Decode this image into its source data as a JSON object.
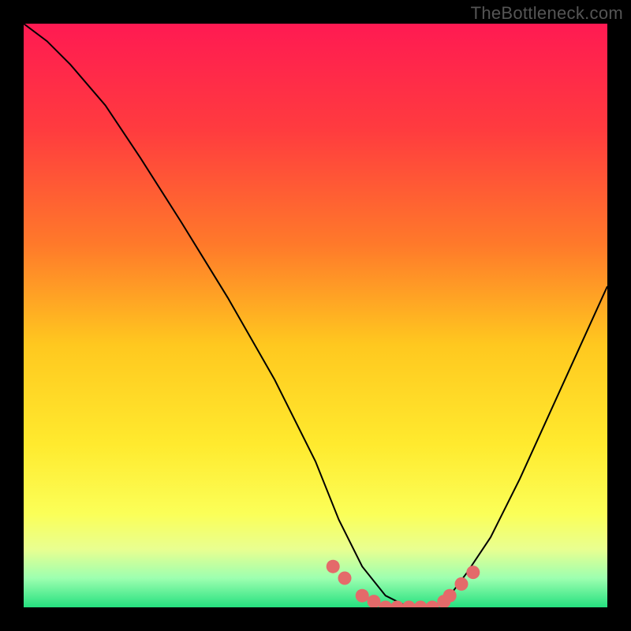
{
  "watermark": "TheBottleneck.com",
  "chart_data": {
    "type": "line",
    "title": "",
    "xlabel": "",
    "ylabel": "",
    "xlim": [
      0,
      100
    ],
    "ylim": [
      0,
      100
    ],
    "grid": false,
    "legend": false,
    "gradient_stops": [
      {
        "offset": 0,
        "color": "#ff1a52"
      },
      {
        "offset": 18,
        "color": "#ff3b3f"
      },
      {
        "offset": 38,
        "color": "#ff7a2a"
      },
      {
        "offset": 55,
        "color": "#ffc81f"
      },
      {
        "offset": 72,
        "color": "#ffea2e"
      },
      {
        "offset": 84,
        "color": "#fbff58"
      },
      {
        "offset": 90,
        "color": "#e9ff90"
      },
      {
        "offset": 95,
        "color": "#9dffb0"
      },
      {
        "offset": 100,
        "color": "#25e07f"
      }
    ],
    "series": [
      {
        "name": "curve",
        "color": "#000000",
        "x": [
          0,
          4,
          8,
          14,
          20,
          27,
          35,
          43,
          50,
          54,
          58,
          62,
          66,
          70,
          73,
          76,
          80,
          85,
          90,
          95,
          100
        ],
        "y": [
          100,
          97,
          93,
          86,
          77,
          66,
          53,
          39,
          25,
          15,
          7,
          2,
          0,
          0,
          2,
          6,
          12,
          22,
          33,
          44,
          55
        ]
      }
    ],
    "markers": {
      "name": "highlight-dots",
      "color": "#e46a6a",
      "x": [
        53,
        55,
        58,
        60,
        62,
        64,
        66,
        68,
        70,
        72,
        73,
        75,
        77
      ],
      "y": [
        7,
        5,
        2,
        1,
        0,
        0,
        0,
        0,
        0,
        1,
        2,
        4,
        6
      ]
    }
  }
}
